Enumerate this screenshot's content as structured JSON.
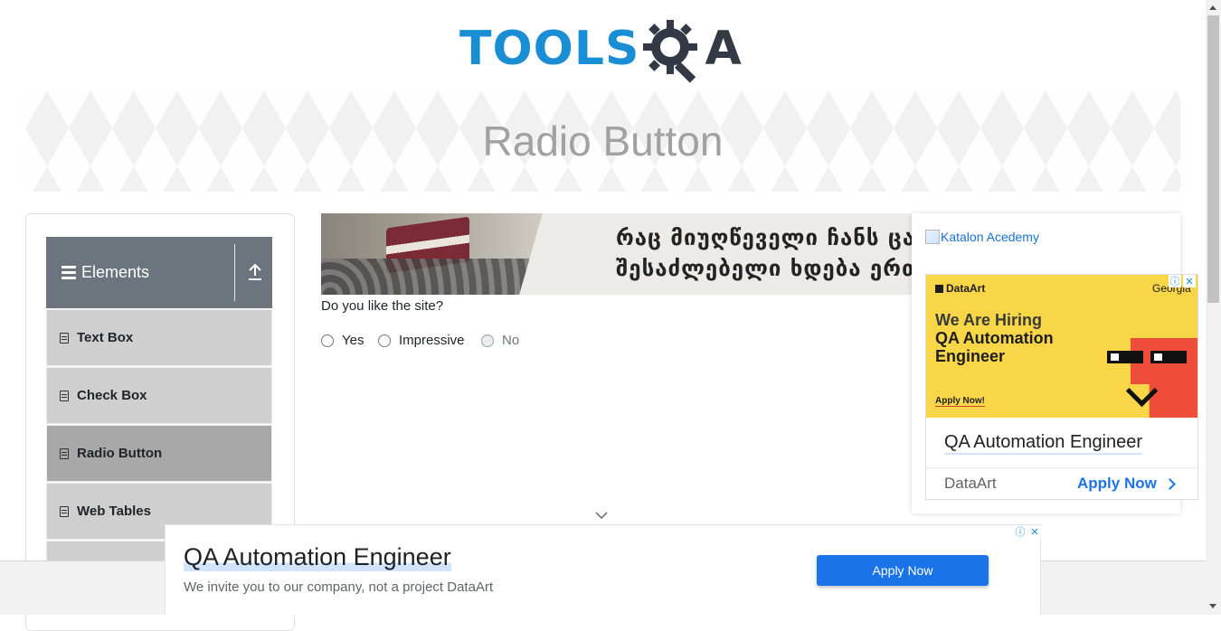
{
  "logo": {
    "tools_text": "TOOLS",
    "qa_text": "A",
    "brand_colors": {
      "tools": "#1a8ed4",
      "qa": "#333a45"
    }
  },
  "header": {
    "title": "Radio Button"
  },
  "sidebar": {
    "group_title": "Elements",
    "group_icon": "hamburger-icon",
    "collapse_icon": "upload-arrow-icon",
    "items": [
      {
        "label": "Text Box",
        "icon": "html5-icon",
        "active": false
      },
      {
        "label": "Check Box",
        "icon": "html5-icon",
        "active": false
      },
      {
        "label": "Radio Button",
        "icon": "html5-icon",
        "active": true
      },
      {
        "label": "Web Tables",
        "icon": "html5-icon",
        "active": false
      }
    ]
  },
  "banner": {
    "line1": "რაც მიუღწეველი ჩანს ცალკე",
    "line2": "შესაძლებელი ხდება ერთად"
  },
  "form": {
    "question": "Do you like the site?",
    "options": [
      {
        "label": "Yes",
        "disabled": false
      },
      {
        "label": "Impressive",
        "disabled": false
      },
      {
        "label": "No",
        "disabled": true
      }
    ]
  },
  "right_ad": {
    "image_alt": "Katalon Acedemy",
    "brand": "DataArt",
    "location": "Georgia",
    "hiring": "We Are Hiring",
    "role": "QA Automation Engineer",
    "apply_small": "Apply Now!",
    "headline": "QA Automation Engineer",
    "advertiser": "DataArt",
    "cta": "Apply Now",
    "adchoices_icons": [
      "info-icon",
      "close-icon"
    ]
  },
  "bottom_ad": {
    "headline": "QA Automation Engineer",
    "subline": "We invite you to our company, not a project DataArt",
    "button": "Apply Now",
    "adchoices_icons": [
      "info-icon",
      "close-icon"
    ]
  },
  "colors": {
    "accent_blue": "#1a73e8",
    "sidebar_header": "#6c757d",
    "sidebar_item": "#cfcfcf",
    "sidebar_active": "#a8a8a8",
    "ad_yellow": "#f9d648"
  }
}
